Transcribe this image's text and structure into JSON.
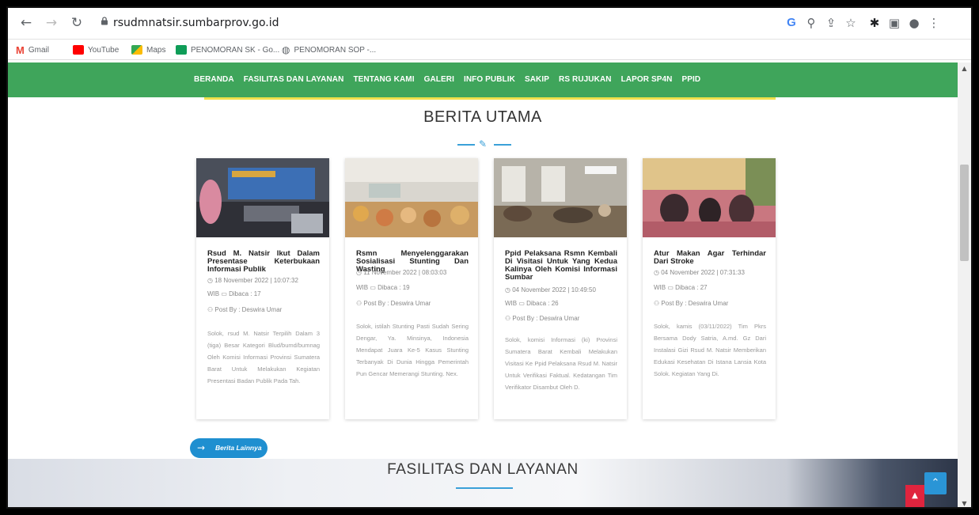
{
  "browser": {
    "url": "rsudmnatsir.sumbarprov.go.id",
    "bookmarks": [
      {
        "label": "Gmail",
        "color": "#ea4335"
      },
      {
        "label": "YouTube",
        "color": "#ff0000"
      },
      {
        "label": "Maps",
        "color": "#34a853"
      },
      {
        "label": "PENOMORAN SK - Go...",
        "color": "#0f9d58"
      },
      {
        "label": "PENOMORAN SOP -...",
        "color": "#5f6368"
      }
    ]
  },
  "nav": {
    "items": [
      "BERANDA",
      "FASILITAS DAN LAYANAN",
      "TENTANG KAMI",
      "GALERI",
      "INFO PUBLIK",
      "SAKIP",
      "RS RUJUKAN",
      "LAPOR SP4N",
      "PPID"
    ],
    "bg_color": "#3fa55b"
  },
  "section": {
    "title": "BERITA UTAMA"
  },
  "cards": [
    {
      "title": "Rsud M. Natsir Ikut Dalam Presentase Keterbukaan Informasi Publik",
      "date": "18 November 2022 | 10:07:32",
      "wib": "WIB",
      "views": "Dibaca : 17",
      "author": "Post By : Deswira Umar",
      "excerpt": "Solok, rsud M. Natsir Terpilih Dalam 3 (tiga) Besar Kategori Blud/bumd/bumnag Oleh Komisi Informasi Provinsi Sumatera Barat Untuk Melakukan Kegiatan Presentasi Badan Publik Pada Tah."
    },
    {
      "title": "Rsmn Menyelenggarakan Sosialisasi Stunting Dan Wasting",
      "date": "11 November 2022 | 08:03:03",
      "wib": "WIB",
      "views": "Dibaca : 19",
      "author": "Post By : Deswira Umar",
      "excerpt": "Solok, istilah Stunting Pasti Sudah Sering Dengar, Ya. Minsinya, Indonesia Mendapat Juara Ke-5 Kasus Stunting Terbanyak Di Dunia Hingga Pemerintah Pun Gencar Memerangi Stunting. Nex."
    },
    {
      "title": "Ppid Pelaksana Rsmn Kembali Di Visitasi Untuk Yang Kedua Kalinya Oleh Komisi Informasi Sumbar",
      "date": "04 November 2022 | 10:49:50",
      "wib": "WIB",
      "views": "Dibaca : 26",
      "author": "Post By : Deswira Umar",
      "excerpt": "Solok, komisi Informasi (ki) Provinsi Sumatera Barat Kembali Melakukan Visitasi Ke Ppid Pelaksana Rsud M. Natsir Untuk Verifikasi Faktual. Kedatangan Tim Verifikator Disambut Oleh D."
    },
    {
      "title": "Atur Makan Agar Terhindar Dari Stroke",
      "date": "04 November 2022 | 07:31:33",
      "wib": "WIB",
      "views": "Dibaca : 27",
      "author": "Post By : Deswira Umar",
      "excerpt": "Solok, kamis (03/11/2022) Tim Pkrs Bersama Dody Satria, A.md. Gz Dari Instalasi Gizi Rsud M. Natsir Memberikan Edukasi Kesehatan Di Istana Lansia Kota Solok. Kegiatan Yang Di."
    }
  ],
  "more_button": "Berita Lainnya",
  "banner": {
    "title": "FASILITAS DAN LAYANAN"
  },
  "colors": {
    "accent": "#1f8fd0",
    "nav_green": "#3fa55b",
    "highlight": "#f0e04c"
  }
}
